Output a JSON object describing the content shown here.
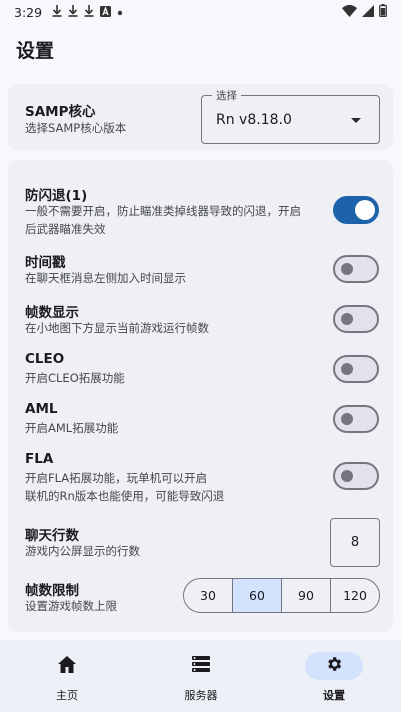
{
  "status_bar": {
    "time": "3:29",
    "icons": [
      "download-icon",
      "download-icon",
      "download-icon",
      "app-a-icon",
      "dot-icon"
    ],
    "right_icons": [
      "wifi-icon",
      "signal-icon",
      "battery-icon"
    ]
  },
  "page": {
    "title": "设置"
  },
  "core_card": {
    "title": "SAMP核心",
    "subtitle": "选择SAMP核心版本",
    "select_label": "选择",
    "select_value": "Rn v8.18.0"
  },
  "settings": {
    "anti_crash": {
      "title": "防闪退(1)",
      "desc_line1": "一般不需要开启，防止瞄准类掉线器导致的闪退，开启",
      "desc_line2": "后武器瞄准失效",
      "on": true
    },
    "timestamp": {
      "title": "时间戳",
      "desc": "在聊天框消息左侧加入时间显示",
      "on": false
    },
    "fps_display": {
      "title": "帧数显示",
      "desc": "在小地图下方显示当前游戏运行帧数",
      "on": false
    },
    "cleo": {
      "title": "CLEO",
      "desc": "开启CLEO拓展功能",
      "on": false
    },
    "aml": {
      "title": "AML",
      "desc": "开启AML拓展功能",
      "on": false
    },
    "fla": {
      "title": "FLA",
      "desc_line1": "开启FLA拓展功能，玩单机可以开启",
      "desc_line2": "联机的Rn版本也能使用，可能导致闪退",
      "on": false
    },
    "chat_lines": {
      "title": "聊天行数",
      "desc": "游戏内公屏显示的行数",
      "value": "8"
    },
    "fps_limit": {
      "title": "帧数限制",
      "desc": "设置游戏帧数上限",
      "options": [
        "30",
        "60",
        "90",
        "120"
      ],
      "selected": "60"
    }
  },
  "bottom_nav": {
    "items": [
      {
        "label": "主页",
        "icon": "home-icon"
      },
      {
        "label": "服务器",
        "icon": "server-list-icon"
      },
      {
        "label": "设置",
        "icon": "gear-icon"
      }
    ],
    "active": 2
  },
  "colors": {
    "accent": "#1e63a9",
    "accent_container": "#d3e3fd",
    "card_bg": "#eef0f5",
    "page_bg": "#f7f8fb",
    "outline": "#75767f"
  }
}
